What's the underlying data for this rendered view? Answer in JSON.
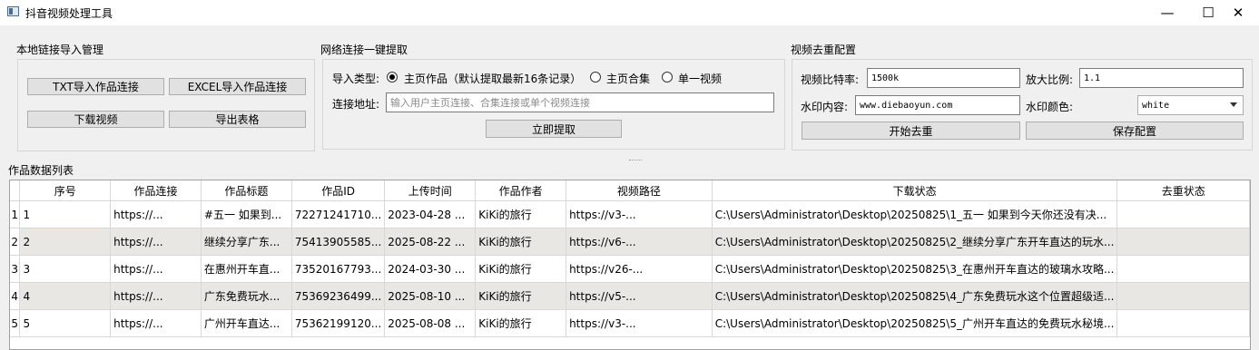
{
  "window": {
    "title": "抖音视频处理工具",
    "controls": [
      "—",
      "☐",
      "✕"
    ]
  },
  "local_import": {
    "title": "本地链接导入管理",
    "txt_button": "TXT导入作品连接",
    "excel_button": "EXCEL导入作品连接",
    "download_button": "下载视频",
    "export_button": "导出表格"
  },
  "network": {
    "title": "网络连接一键提取",
    "import_type_label": "导入类型:",
    "options": [
      "主页作品（默认提取最新16条记录）",
      "主页合集",
      "单一视频"
    ],
    "selected_option": 0,
    "url_label": "连接地址:",
    "url_placeholder": "输入用户主页连接、合集连接或单个视频连接",
    "extract_button": "立即提取"
  },
  "dedup": {
    "title": "视频去重配置",
    "bitrate_label": "视频比特率:",
    "bitrate_value": "1500k",
    "scale_label": "放大比例:",
    "scale_value": "1.1",
    "watermark_label": "水印内容:",
    "watermark_value": "www.diebaoyun.com",
    "watermark_color_label": "水印颜色:",
    "watermark_color_value": "white",
    "start_button": "开始去重",
    "save_button": "保存配置"
  },
  "table": {
    "title": "作品数据列表",
    "columns": [
      "序号",
      "作品连接",
      "作品标题",
      "作品ID",
      "上传时间",
      "作品作者",
      "视频路径",
      "下载状态",
      "去重状态"
    ],
    "rows": [
      [
        "1",
        "1",
        "https://...",
        "#五一 如果到...",
        "72271241710...",
        "2023-04-28 ...",
        "KiKi的旅行",
        "https://v3-...",
        "C:\\Users\\Administrator\\Desktop\\20250825\\1_五一 如果到今天你还没有决...",
        ""
      ],
      [
        "2",
        "2",
        "https://...",
        "继续分享广东...",
        "75413905585...",
        "2025-08-22 ...",
        "KiKi的旅行",
        "https://v6-...",
        "C:\\Users\\Administrator\\Desktop\\20250825\\2_继续分享广东开车直达的玩水...",
        ""
      ],
      [
        "3",
        "3",
        "https://...",
        "在惠州开车直...",
        "73520167793...",
        "2024-03-30 ...",
        "KiKi的旅行",
        "https://v26-...",
        "C:\\Users\\Administrator\\Desktop\\20250825\\3_在惠州开车直达的玻璃水攻略...",
        ""
      ],
      [
        "4",
        "4",
        "https://...",
        "广东免费玩水...",
        "75369236499...",
        "2025-08-10 ...",
        "KiKi的旅行",
        "https://v5-...",
        "C:\\Users\\Administrator\\Desktop\\20250825\\4_广东免费玩水这个位置超级适...",
        ""
      ],
      [
        "5",
        "5",
        "https://...",
        "广州开车直达...",
        "75362199120...",
        "2025-08-08 ...",
        "KiKi的旅行",
        "https://v3-...",
        "C:\\Users\\Administrator\\Desktop\\20250825\\5_广州开车直达的免费玩水秘境...",
        ""
      ]
    ]
  }
}
